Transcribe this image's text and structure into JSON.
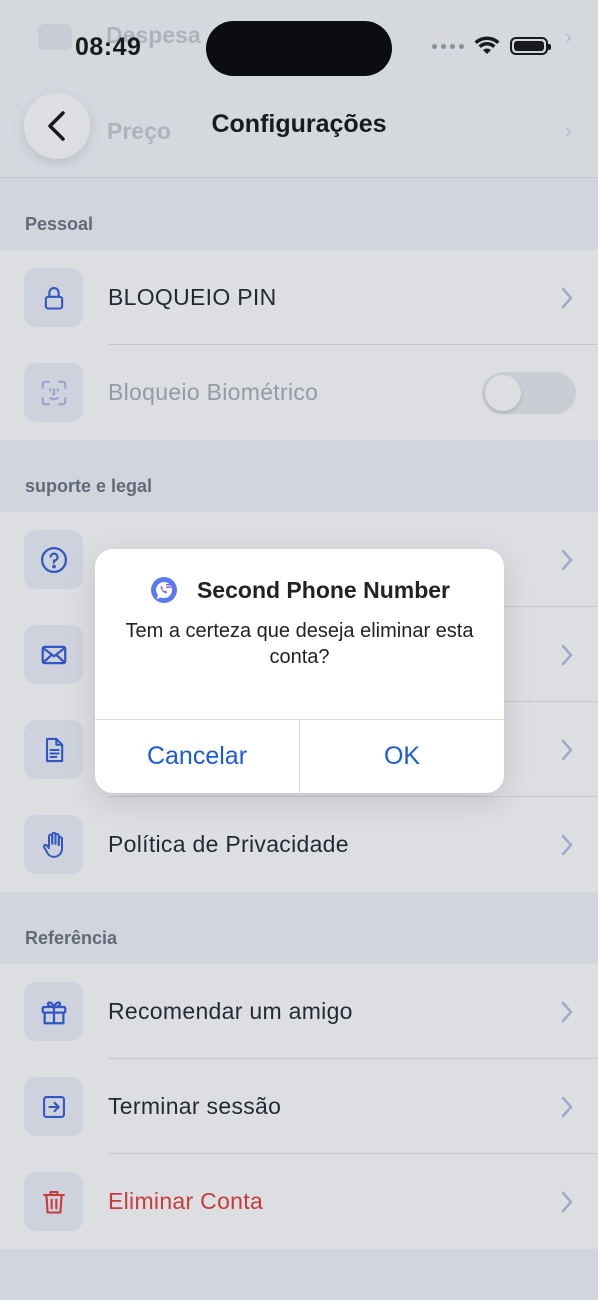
{
  "status_bar": {
    "time": "08:49"
  },
  "background_header": {
    "row1": "Despesa",
    "row2": "Preço"
  },
  "header": {
    "title": "Configurações"
  },
  "sections": {
    "personal": {
      "label": "Pessoal",
      "items": [
        {
          "label": "BLOQUEIO PIN",
          "icon": "lock-icon"
        },
        {
          "label": "Bloqueio Biométrico",
          "icon": "face-id-icon",
          "toggle": false
        }
      ]
    },
    "support": {
      "label": "suporte e legal",
      "items": [
        {
          "label": "",
          "icon": "help-icon"
        },
        {
          "label": "",
          "icon": "mail-icon"
        },
        {
          "label": "",
          "icon": "document-icon"
        },
        {
          "label": "Política de Privacidade",
          "icon": "hand-icon"
        }
      ]
    },
    "referral": {
      "label": "Referência",
      "items": [
        {
          "label": "Recomendar um amigo",
          "icon": "gift-icon"
        },
        {
          "label": "Terminar sessão",
          "icon": "logout-icon"
        },
        {
          "label": "Eliminar Conta",
          "icon": "trash-icon"
        }
      ]
    }
  },
  "dialog": {
    "app_name": "Second Phone Number",
    "message": "Tem a certeza que deseja eliminar esta conta?",
    "cancel_label": "Cancelar",
    "ok_label": "OK"
  },
  "colors": {
    "accent": "#2f5bd9",
    "danger": "#e53935",
    "icon_bg": "#eef1fa",
    "dialog_button": "#1a5bd9"
  }
}
